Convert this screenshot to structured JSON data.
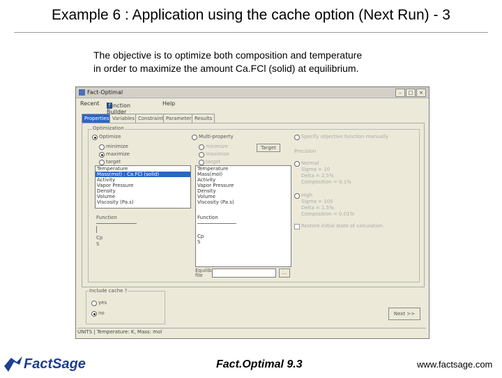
{
  "slide": {
    "title": "Example 6 : Application using the cache option (Next Run) - 3",
    "objective_line1": "The objective is to optimize both composition and temperature",
    "objective_line2": "in order to maximize the amount Ca.FCl (solid) at equilibrium."
  },
  "window": {
    "title": "Fact-Optimal",
    "menu": [
      "Recent",
      "Function Builder",
      "Help"
    ],
    "tabs": [
      "Properties",
      "Variables",
      "Constraints",
      "Parameters",
      "Results"
    ],
    "active_tab": "Properties"
  },
  "objective1": {
    "group_label": "Optimization",
    "radio_label": "Optimize",
    "options": [
      "minimize",
      "maximize",
      "target"
    ],
    "selected_option": "maximize",
    "list_items": [
      "Temperature",
      "Mass(mol) : Ca.FCl (solid)",
      "Activity",
      "Vapor Pressure",
      "Density",
      "Volume",
      "Viscosity (Pa.s)"
    ],
    "selected_item": "Mass(mol) : Ca.FCl (solid)",
    "function_label": "Function",
    "extra_items": [
      "Cp",
      "S"
    ]
  },
  "objective2": {
    "radio_label": "Multi-property",
    "options": [
      "minimize",
      "maximize",
      "target"
    ],
    "button": "Target",
    "list_items": [
      "Temperature",
      "Mass(mol)",
      "Activity",
      "Vapor Pressure",
      "Density",
      "Volume",
      "Viscosity (Pa.s)"
    ],
    "function_label": "Function",
    "extra_items": [
      "Cp",
      "S"
    ],
    "equilib_label": "Equilib file",
    "browse": "..."
  },
  "objective3": {
    "radio_label": "Specify objective function manually",
    "precision_label": "Precision",
    "normal_label": "Normal",
    "normal_values": [
      "Sigma = 10",
      "Delta = 2.5%",
      "Composition = 0.1%"
    ],
    "high_label": "High",
    "high_values": [
      "Sigma = 100",
      "Delta = 1.5%",
      "Composition = 0.01%"
    ],
    "restore_label": "Restore initial state of calculation"
  },
  "cache": {
    "group_label": "Include cache ?",
    "options": [
      "yes",
      "no"
    ],
    "selected": "no"
  },
  "next_button": "Next >>",
  "status_bar": "UNITS | Temperature: K, Mass: mol",
  "footer": {
    "logo": "FactSage",
    "center": "Fact.Optimal   9.3",
    "url": "www.factsage.com"
  },
  "colors": {
    "selection": "#2a66c8",
    "logo": "#1f3f8f"
  }
}
